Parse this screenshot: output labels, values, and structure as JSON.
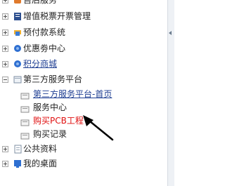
{
  "menu": {
    "items": [
      {
        "label": "售后服务",
        "icon": "service-icon"
      },
      {
        "label": "增值税票开票管理",
        "icon": "invoice-icon"
      },
      {
        "label": "预付款系统",
        "icon": "prepay-icon"
      },
      {
        "label": "优惠劵中心",
        "icon": "coupon-icon"
      },
      {
        "label": "积分商城",
        "icon": "points-mall-icon"
      },
      {
        "label": "第三方服务平台",
        "icon": "folder-icon"
      },
      {
        "label": "公共资料",
        "icon": "public-docs-icon"
      },
      {
        "label": "我的桌面",
        "icon": "desktop-icon"
      }
    ],
    "subitems": [
      {
        "label": "第三方服务平台-首页"
      },
      {
        "label": "服务中心"
      },
      {
        "label": "购买PCB工程"
      },
      {
        "label": "购买记录"
      }
    ]
  },
  "colors": {
    "link": "#1f3f93",
    "highlight": "#e01010",
    "arrow": "#000000"
  }
}
